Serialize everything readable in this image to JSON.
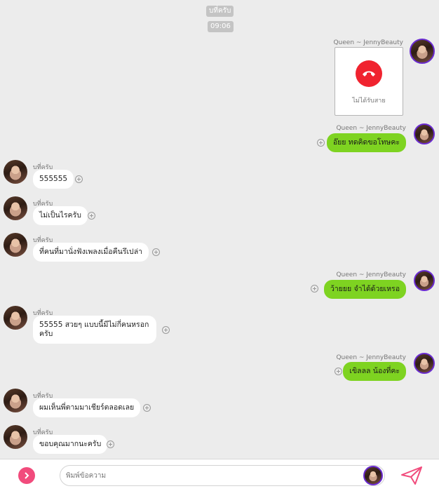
{
  "header": {
    "date_label": "บที่ครับ",
    "time_label": "09:06"
  },
  "call": {
    "sender": "Queen ~ JennyBeauty",
    "status_text": "ไม่ได้รับสาย"
  },
  "messages": [
    {
      "side": "out",
      "sender": "Queen ~ JennyBeauty",
      "text": "อ๊ยย ทดคิดขอโทษคะ"
    },
    {
      "side": "in",
      "sender": "บที่ครับ",
      "text": "555555"
    },
    {
      "side": "in",
      "sender": "บที่ครับ",
      "text": "ไม่เป็นไรครับ"
    },
    {
      "side": "in",
      "sender": "บที่ครับ",
      "text": "ที่คนที่มานั่งฟังเพลงเมื่อคืนรึเปล่า"
    },
    {
      "side": "out",
      "sender": "Queen ~ JennyBeauty",
      "text": "ว้ายยย จำได้ด้วยเหรอ"
    },
    {
      "side": "in",
      "sender": "บที่ครับ",
      "text": "55555 สวยๆ แบบนี้มีไม่กี่คนหรอก ครับ"
    },
    {
      "side": "out",
      "sender": "Queen ~ JennyBeauty",
      "text": "เขิลลล น้องที่คะ"
    },
    {
      "side": "in",
      "sender": "บที่ครับ",
      "text": "ผมเห็นพี่ตามมาเชียร์ตลอดเลย"
    },
    {
      "side": "in",
      "sender": "บที่ครับ",
      "text": "ขอบคุณมากนะครับ"
    }
  ],
  "composer": {
    "placeholder": "พิมพ์ข้อความ"
  },
  "colors": {
    "outgoing_bubble": "#7ed321",
    "incoming_bubble": "#ffffff",
    "call_icon": "#f0232f",
    "add_button": "#f14b7c",
    "send_icon": "#f14b7c",
    "avatar_ring": "#6a2bd1"
  }
}
